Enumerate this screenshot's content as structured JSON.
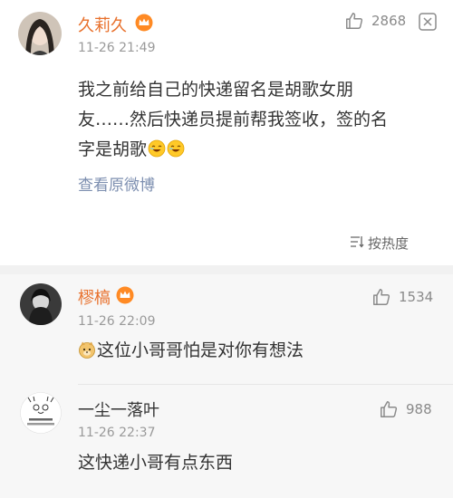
{
  "post": {
    "user": "久莉久",
    "time": "11-26 21:49",
    "likes": "2868",
    "text_line1": "我之前给自己的快递留名是胡歌女朋",
    "text_line2": "友……然后快递员提前帮我签收，签的名",
    "text_line3": "字是胡歌",
    "view_original": "查看原微博",
    "sort_label": "按热度"
  },
  "comments": [
    {
      "user": "樛槁",
      "time": "11-26 22:09",
      "likes": "1534",
      "text": "这位小哥哥怕是对你有想法"
    },
    {
      "user": "一尘一落叶",
      "time": "11-26 22:37",
      "likes": "988",
      "text": "这快递小哥有点东西"
    }
  ],
  "colors": {
    "username": "#e86f2a",
    "link": "#7d8fb0",
    "timestamp": "#9a9a9a"
  }
}
